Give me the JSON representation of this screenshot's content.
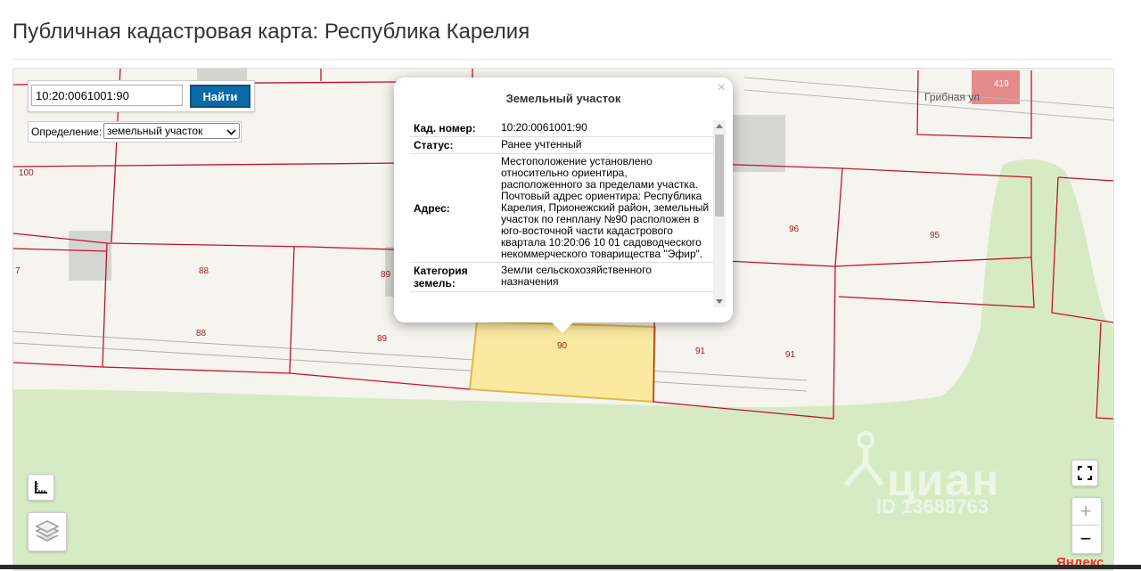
{
  "page": {
    "title": "Публичная кадастровая карта: Республика Карелия"
  },
  "search": {
    "value": "10:20:0061001:90",
    "button_label": "Найти"
  },
  "definition": {
    "label": "Определение:",
    "selected": "земельный участок"
  },
  "popup": {
    "title": "Земельный участок",
    "close": "×",
    "rows": [
      {
        "key": "Кад. номер:",
        "value": "10:20:0061001:90"
      },
      {
        "key": "Статус:",
        "value": "Ранее учтенный"
      },
      {
        "key": "Адрес:",
        "value": "Местоположение установлено относительно ориентира, расположенного за пределами участка. Почтовый адрес ориентира: Республика Карелия, Прионежский район, земельный участок по генплану №90 расположен в юго-восточной части кадастрового квартала 10:20:06 10 01 садоводческого некоммерческого товарищества \"Эфир\"."
      },
      {
        "key": "Категория земель:",
        "value": "Земли сельскохозяйственного назначения"
      }
    ]
  },
  "map": {
    "street_label": "Грибная ул",
    "building_label": "419",
    "parcel_labels": [
      "100",
      "7",
      "88",
      "88",
      "89",
      "89",
      "90",
      "91",
      "91",
      "96",
      "95"
    ]
  },
  "controls": {
    "zoom_in": "+",
    "zoom_out": "−"
  },
  "watermark": {
    "name": "циан",
    "id": "ID 13688763"
  },
  "attribution": {
    "logo": "Яндекс"
  },
  "colors": {
    "parcel_border": "#c8102e",
    "selected_fill": "#fbe9a0",
    "forest": "#d6ebc4",
    "button": "#0a6aa8"
  }
}
